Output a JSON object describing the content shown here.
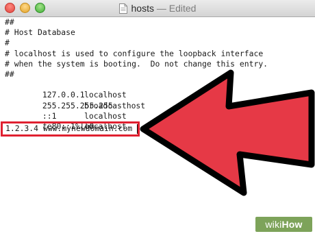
{
  "window": {
    "title": "hosts",
    "separator": "—",
    "status": "Edited"
  },
  "file_lines": [
    "##",
    "# Host Database",
    "#",
    "# localhost is used to configure the loopback interface",
    "# when the system is booting.  Do not change this entry.",
    "##"
  ],
  "host_entries": [
    {
      "address": "127.0.0.1",
      "name": "localhost"
    },
    {
      "address": "255.255.255.255",
      "name": "broadcasthost"
    },
    {
      "address": "::1",
      "name": "localhost"
    },
    {
      "address": "fe80::1%lo0",
      "name": "localhost"
    }
  ],
  "new_entry": "1.2.3.4 www.mynewdomain.com",
  "watermark": {
    "part1": "wiki",
    "part2": "How"
  },
  "colors": {
    "highlight": "#e02030",
    "arrow_fill": "#e63946",
    "arrow_outline": "#000000",
    "watermark_bg": "#7da35a"
  },
  "icons": {
    "close": "close-icon",
    "minimize": "minimize-icon",
    "zoom": "zoom-icon",
    "document": "document-icon",
    "arrow": "arrow-icon"
  }
}
